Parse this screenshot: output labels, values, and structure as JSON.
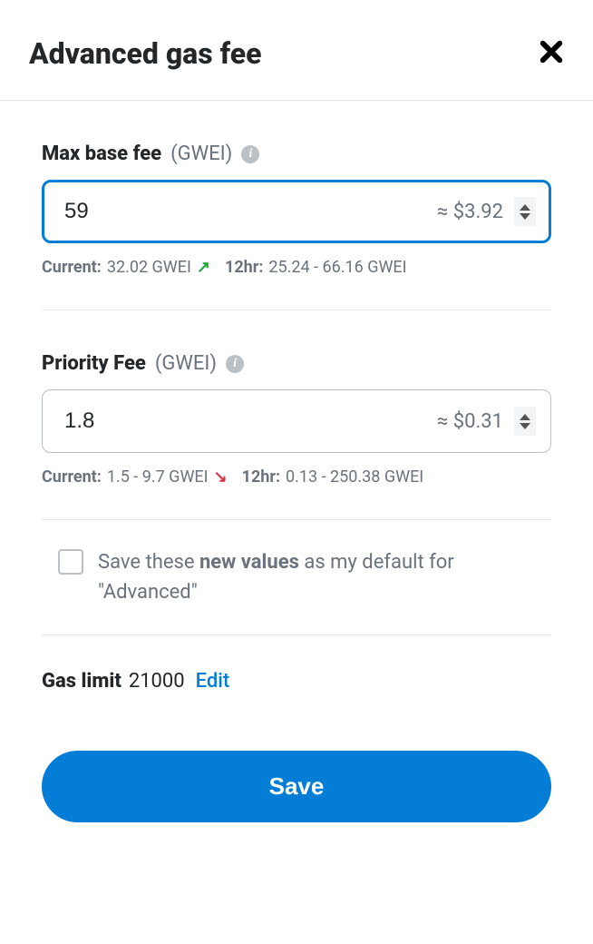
{
  "header": {
    "title": "Advanced gas fee"
  },
  "maxBaseFee": {
    "label": "Max base fee",
    "unit": "(GWEI)",
    "value": "59",
    "usd": "≈ $3.92",
    "currentLabel": "Current:",
    "currentValue": "32.02 GWEI",
    "trend": "up",
    "range12Label": "12hr:",
    "range12Value": "25.24 - 66.16 GWEI"
  },
  "priorityFee": {
    "label": "Priority Fee",
    "unit": "(GWEI)",
    "value": "1.8",
    "usd": "≈ $0.31",
    "currentLabel": "Current:",
    "currentValue": "1.5 - 9.7 GWEI",
    "trend": "down",
    "range12Label": "12hr:",
    "range12Value": "0.13 - 250.38 GWEI"
  },
  "saveDefault": {
    "prefix": "Save these ",
    "bold": "new values",
    "suffix": " as my default for \"Advanced\""
  },
  "gasLimit": {
    "label": "Gas limit",
    "value": "21000",
    "edit": "Edit"
  },
  "footer": {
    "save": "Save"
  }
}
